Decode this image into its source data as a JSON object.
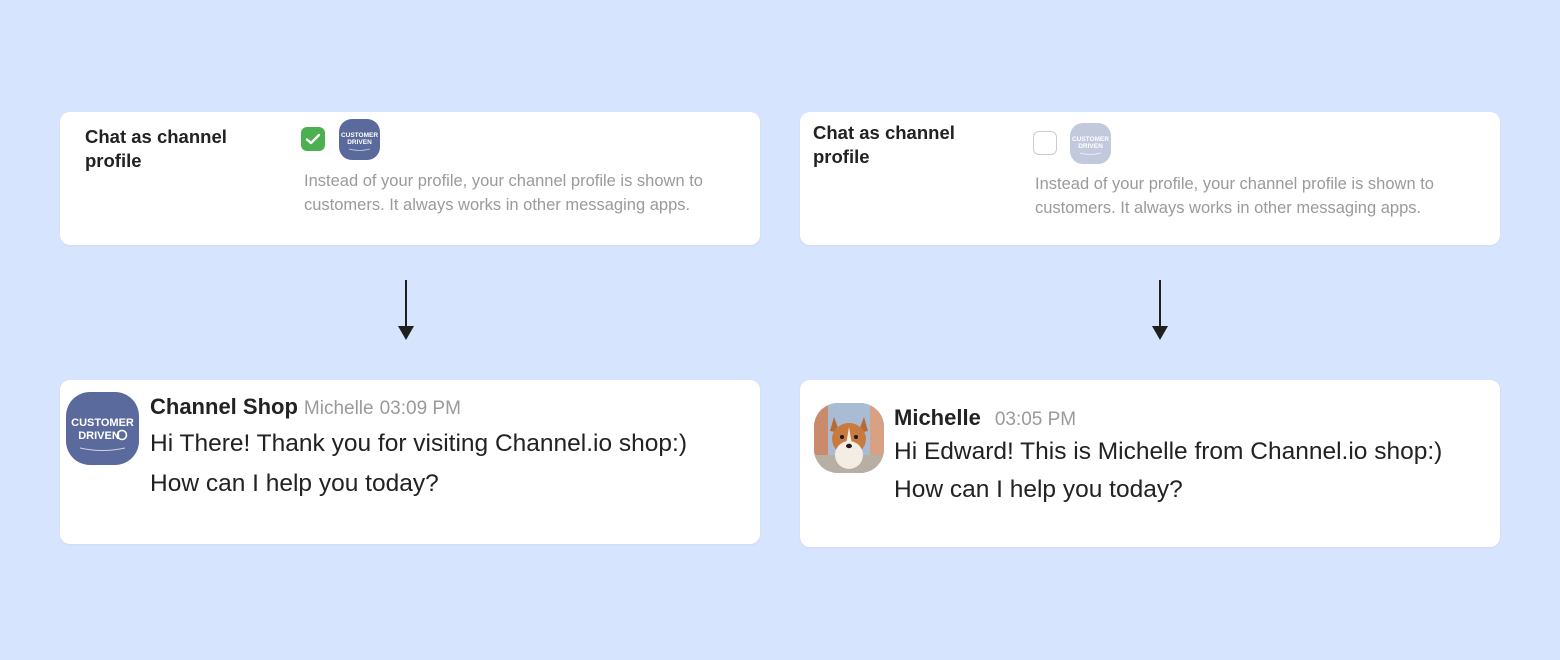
{
  "left": {
    "setting": {
      "title": "Chat as channel profile",
      "checked": true,
      "description": "Instead of your profile, your channel profile is shown to customers. It always works in other messaging apps."
    },
    "message": {
      "sender": "Channel Shop",
      "agent": "Michelle",
      "time": "03:09 PM",
      "line1": "Hi There! Thank you for visiting Channel.io shop:)",
      "line2": "How can I help you today?",
      "avatar": "customer-driven-logo"
    }
  },
  "right": {
    "setting": {
      "title": "Chat as channel profile",
      "checked": false,
      "description": "Instead of your profile, your channel profile is shown to customers. It always works in other messaging apps."
    },
    "message": {
      "sender": "Michelle",
      "time": "03:05 PM",
      "line1": "Hi Edward! This is Michelle from Channel.io shop:)",
      "line2": "How can I help you today?",
      "avatar": "corgi-photo"
    }
  },
  "logo": {
    "line1": "CUSTOMER",
    "line2": "DRIVEN"
  },
  "colors": {
    "background": "#d6e4fd",
    "check_green": "#4caf50",
    "logo_blue": "#5b6a9c",
    "muted_text": "#9a9a9a"
  },
  "icons": {
    "check": "check-icon",
    "arrow": "arrow-down-icon"
  }
}
